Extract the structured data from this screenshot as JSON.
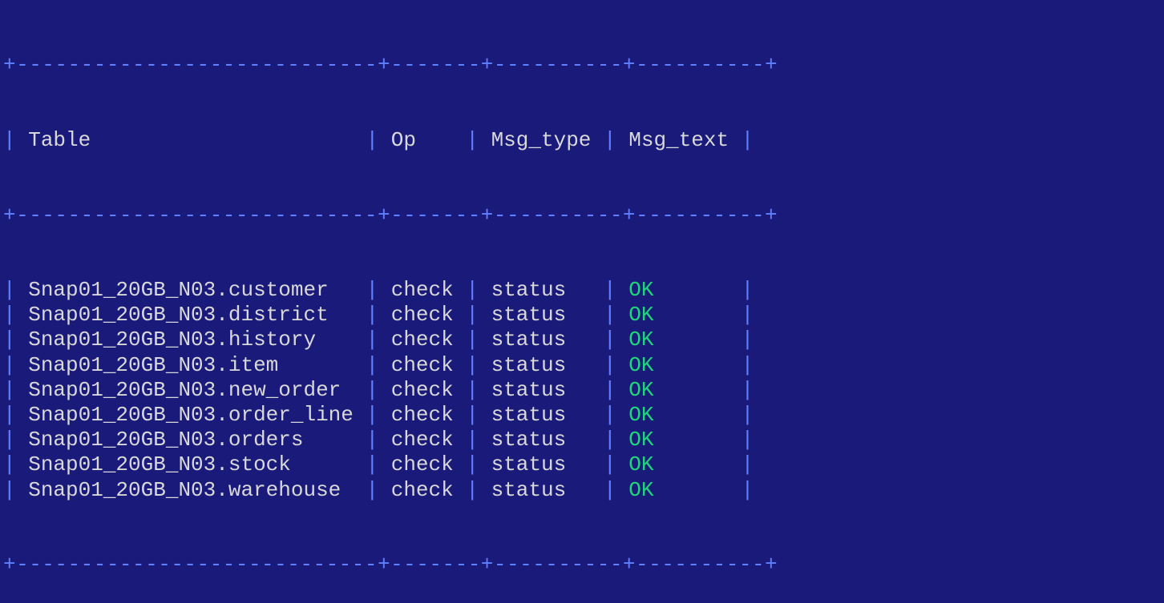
{
  "table": {
    "border_top": "+----------------------------+-------+----------+----------+",
    "border_mid": "+----------------------------+-------+----------+----------+",
    "border_bottom": "+----------------------------+-------+----------+----------+",
    "headers": {
      "col1": "Table",
      "col2": "Op",
      "col3": "Msg_type",
      "col4": "Msg_text"
    },
    "col_widths": {
      "col1": 27,
      "col2": 6,
      "col3": 9,
      "col4": 9
    },
    "rows": [
      {
        "table": "Snap01_20GB_N03.customer",
        "op": "check",
        "msg_type": "status",
        "msg_text": "OK"
      },
      {
        "table": "Snap01_20GB_N03.district",
        "op": "check",
        "msg_type": "status",
        "msg_text": "OK"
      },
      {
        "table": "Snap01_20GB_N03.history",
        "op": "check",
        "msg_type": "status",
        "msg_text": "OK"
      },
      {
        "table": "Snap01_20GB_N03.item",
        "op": "check",
        "msg_type": "status",
        "msg_text": "OK"
      },
      {
        "table": "Snap01_20GB_N03.new_order",
        "op": "check",
        "msg_type": "status",
        "msg_text": "OK"
      },
      {
        "table": "Snap01_20GB_N03.order_line",
        "op": "check",
        "msg_type": "status",
        "msg_text": "OK"
      },
      {
        "table": "Snap01_20GB_N03.orders",
        "op": "check",
        "msg_type": "status",
        "msg_text": "OK"
      },
      {
        "table": "Snap01_20GB_N03.stock",
        "op": "check",
        "msg_type": "status",
        "msg_text": "OK"
      },
      {
        "table": "Snap01_20GB_N03.warehouse",
        "op": "check",
        "msg_type": "status",
        "msg_text": "OK"
      }
    ]
  }
}
